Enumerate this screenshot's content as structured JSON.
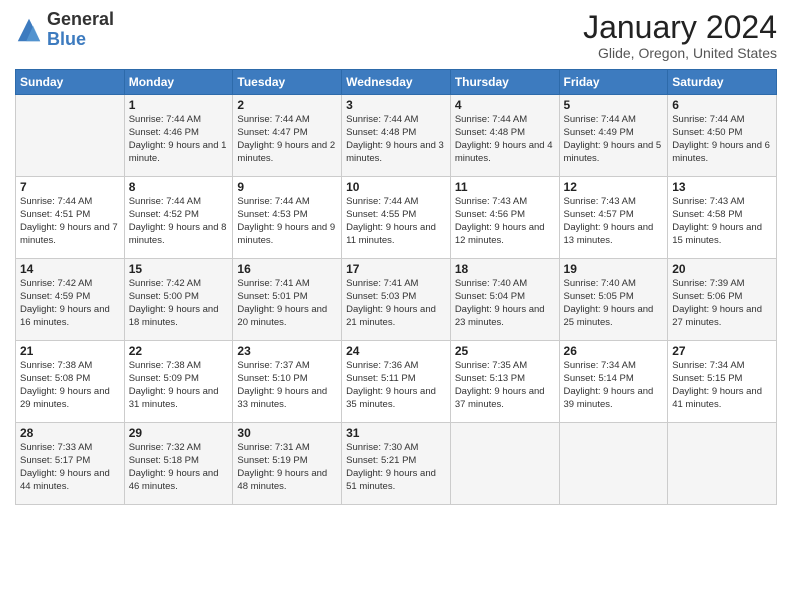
{
  "header": {
    "logo_general": "General",
    "logo_blue": "Blue",
    "month_title": "January 2024",
    "location": "Glide, Oregon, United States"
  },
  "days_of_week": [
    "Sunday",
    "Monday",
    "Tuesday",
    "Wednesday",
    "Thursday",
    "Friday",
    "Saturday"
  ],
  "weeks": [
    [
      {
        "day": "",
        "sunrise": "",
        "sunset": "",
        "daylight": ""
      },
      {
        "day": "1",
        "sunrise": "Sunrise: 7:44 AM",
        "sunset": "Sunset: 4:46 PM",
        "daylight": "Daylight: 9 hours and 1 minute."
      },
      {
        "day": "2",
        "sunrise": "Sunrise: 7:44 AM",
        "sunset": "Sunset: 4:47 PM",
        "daylight": "Daylight: 9 hours and 2 minutes."
      },
      {
        "day": "3",
        "sunrise": "Sunrise: 7:44 AM",
        "sunset": "Sunset: 4:48 PM",
        "daylight": "Daylight: 9 hours and 3 minutes."
      },
      {
        "day": "4",
        "sunrise": "Sunrise: 7:44 AM",
        "sunset": "Sunset: 4:48 PM",
        "daylight": "Daylight: 9 hours and 4 minutes."
      },
      {
        "day": "5",
        "sunrise": "Sunrise: 7:44 AM",
        "sunset": "Sunset: 4:49 PM",
        "daylight": "Daylight: 9 hours and 5 minutes."
      },
      {
        "day": "6",
        "sunrise": "Sunrise: 7:44 AM",
        "sunset": "Sunset: 4:50 PM",
        "daylight": "Daylight: 9 hours and 6 minutes."
      }
    ],
    [
      {
        "day": "7",
        "sunrise": "Sunrise: 7:44 AM",
        "sunset": "Sunset: 4:51 PM",
        "daylight": "Daylight: 9 hours and 7 minutes."
      },
      {
        "day": "8",
        "sunrise": "Sunrise: 7:44 AM",
        "sunset": "Sunset: 4:52 PM",
        "daylight": "Daylight: 9 hours and 8 minutes."
      },
      {
        "day": "9",
        "sunrise": "Sunrise: 7:44 AM",
        "sunset": "Sunset: 4:53 PM",
        "daylight": "Daylight: 9 hours and 9 minutes."
      },
      {
        "day": "10",
        "sunrise": "Sunrise: 7:44 AM",
        "sunset": "Sunset: 4:55 PM",
        "daylight": "Daylight: 9 hours and 11 minutes."
      },
      {
        "day": "11",
        "sunrise": "Sunrise: 7:43 AM",
        "sunset": "Sunset: 4:56 PM",
        "daylight": "Daylight: 9 hours and 12 minutes."
      },
      {
        "day": "12",
        "sunrise": "Sunrise: 7:43 AM",
        "sunset": "Sunset: 4:57 PM",
        "daylight": "Daylight: 9 hours and 13 minutes."
      },
      {
        "day": "13",
        "sunrise": "Sunrise: 7:43 AM",
        "sunset": "Sunset: 4:58 PM",
        "daylight": "Daylight: 9 hours and 15 minutes."
      }
    ],
    [
      {
        "day": "14",
        "sunrise": "Sunrise: 7:42 AM",
        "sunset": "Sunset: 4:59 PM",
        "daylight": "Daylight: 9 hours and 16 minutes."
      },
      {
        "day": "15",
        "sunrise": "Sunrise: 7:42 AM",
        "sunset": "Sunset: 5:00 PM",
        "daylight": "Daylight: 9 hours and 18 minutes."
      },
      {
        "day": "16",
        "sunrise": "Sunrise: 7:41 AM",
        "sunset": "Sunset: 5:01 PM",
        "daylight": "Daylight: 9 hours and 20 minutes."
      },
      {
        "day": "17",
        "sunrise": "Sunrise: 7:41 AM",
        "sunset": "Sunset: 5:03 PM",
        "daylight": "Daylight: 9 hours and 21 minutes."
      },
      {
        "day": "18",
        "sunrise": "Sunrise: 7:40 AM",
        "sunset": "Sunset: 5:04 PM",
        "daylight": "Daylight: 9 hours and 23 minutes."
      },
      {
        "day": "19",
        "sunrise": "Sunrise: 7:40 AM",
        "sunset": "Sunset: 5:05 PM",
        "daylight": "Daylight: 9 hours and 25 minutes."
      },
      {
        "day": "20",
        "sunrise": "Sunrise: 7:39 AM",
        "sunset": "Sunset: 5:06 PM",
        "daylight": "Daylight: 9 hours and 27 minutes."
      }
    ],
    [
      {
        "day": "21",
        "sunrise": "Sunrise: 7:38 AM",
        "sunset": "Sunset: 5:08 PM",
        "daylight": "Daylight: 9 hours and 29 minutes."
      },
      {
        "day": "22",
        "sunrise": "Sunrise: 7:38 AM",
        "sunset": "Sunset: 5:09 PM",
        "daylight": "Daylight: 9 hours and 31 minutes."
      },
      {
        "day": "23",
        "sunrise": "Sunrise: 7:37 AM",
        "sunset": "Sunset: 5:10 PM",
        "daylight": "Daylight: 9 hours and 33 minutes."
      },
      {
        "day": "24",
        "sunrise": "Sunrise: 7:36 AM",
        "sunset": "Sunset: 5:11 PM",
        "daylight": "Daylight: 9 hours and 35 minutes."
      },
      {
        "day": "25",
        "sunrise": "Sunrise: 7:35 AM",
        "sunset": "Sunset: 5:13 PM",
        "daylight": "Daylight: 9 hours and 37 minutes."
      },
      {
        "day": "26",
        "sunrise": "Sunrise: 7:34 AM",
        "sunset": "Sunset: 5:14 PM",
        "daylight": "Daylight: 9 hours and 39 minutes."
      },
      {
        "day": "27",
        "sunrise": "Sunrise: 7:34 AM",
        "sunset": "Sunset: 5:15 PM",
        "daylight": "Daylight: 9 hours and 41 minutes."
      }
    ],
    [
      {
        "day": "28",
        "sunrise": "Sunrise: 7:33 AM",
        "sunset": "Sunset: 5:17 PM",
        "daylight": "Daylight: 9 hours and 44 minutes."
      },
      {
        "day": "29",
        "sunrise": "Sunrise: 7:32 AM",
        "sunset": "Sunset: 5:18 PM",
        "daylight": "Daylight: 9 hours and 46 minutes."
      },
      {
        "day": "30",
        "sunrise": "Sunrise: 7:31 AM",
        "sunset": "Sunset: 5:19 PM",
        "daylight": "Daylight: 9 hours and 48 minutes."
      },
      {
        "day": "31",
        "sunrise": "Sunrise: 7:30 AM",
        "sunset": "Sunset: 5:21 PM",
        "daylight": "Daylight: 9 hours and 51 minutes."
      },
      {
        "day": "",
        "sunrise": "",
        "sunset": "",
        "daylight": ""
      },
      {
        "day": "",
        "sunrise": "",
        "sunset": "",
        "daylight": ""
      },
      {
        "day": "",
        "sunrise": "",
        "sunset": "",
        "daylight": ""
      }
    ]
  ]
}
